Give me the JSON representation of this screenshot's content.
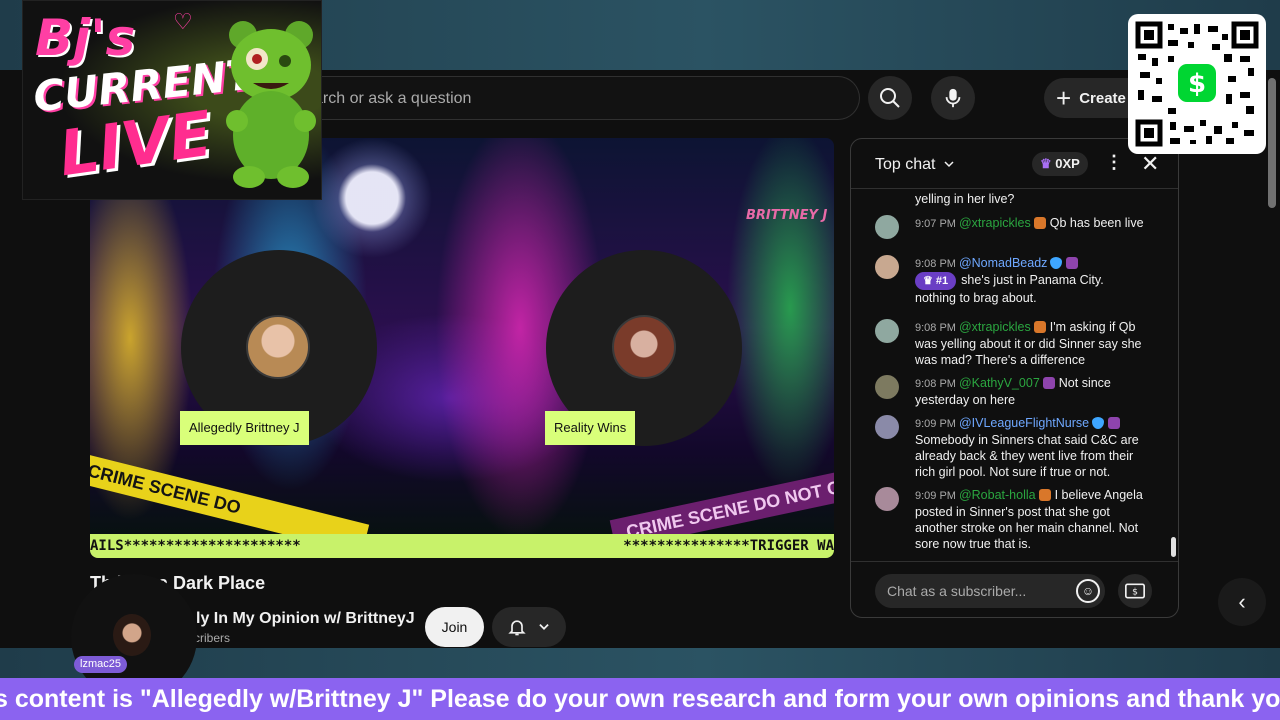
{
  "header": {
    "search_placeholder": "arch or ask a question",
    "create_label": "Create"
  },
  "video": {
    "watermark": "BRITTNEY J",
    "tape_left": "CRIME SCENE DO",
    "tape_right": "CRIME SCENE DO NOT CROSS",
    "ticker_left": "AILS*********************",
    "ticker_right": "***************TRIGGER WA",
    "guests": [
      {
        "name": "Allegedly Brittney J"
      },
      {
        "name": "Reality Wins"
      }
    ],
    "title": "Th       ld is a Dark Place"
  },
  "channel": {
    "name": "ly In My Opinion w/ BrittneyJ",
    "subscribers": "scribers",
    "join_label": "Join"
  },
  "chat": {
    "title": "Top chat",
    "xp": "0XP",
    "messages": [
      {
        "time": "",
        "author": "",
        "text": "yelling in her live?"
      },
      {
        "time": "9:07 PM",
        "author": "@xtrapickles",
        "text": "Qb has been live"
      },
      {
        "time": "9:08 PM",
        "author": "@NomadBeadz",
        "rank": "#1",
        "text": "she's just in Panama City. nothing to brag about."
      },
      {
        "time": "9:08 PM",
        "author": "@xtrapickles",
        "text": "I'm asking if Qb was yelling about it or did Sinner say she was mad? There's a difference"
      },
      {
        "time": "9:08 PM",
        "author": "@KathyV_007",
        "text": "Not since yesterday on here"
      },
      {
        "time": "9:09 PM",
        "author": "@IVLeagueFlightNurse",
        "text": "Somebody in Sinners chat said C&C are already back & they went live from their rich girl pool. Not sure if true or not."
      },
      {
        "time": "9:09 PM",
        "author": "@Robat-holla",
        "text": "I believe Angela posted in Sinner's post that she got another stroke on her main channel. Not sore now true that is."
      }
    ],
    "input_placeholder": "Chat as a subscriber..."
  },
  "overlay": {
    "logo_line1": "Bj's",
    "logo_line2": "CURRENT",
    "logo_line3": "LIVE",
    "viewer_name": "lzmac25",
    "marquee": "s content is \"Allegedly w/Brittney J\" Please do your own research and form your own opinions and thank you"
  },
  "colors": {
    "accent_green": "#2ba640",
    "ticker_lime": "#c8f26a",
    "marquee_purple": "#8b63f0",
    "cashapp_green": "#00d632"
  }
}
